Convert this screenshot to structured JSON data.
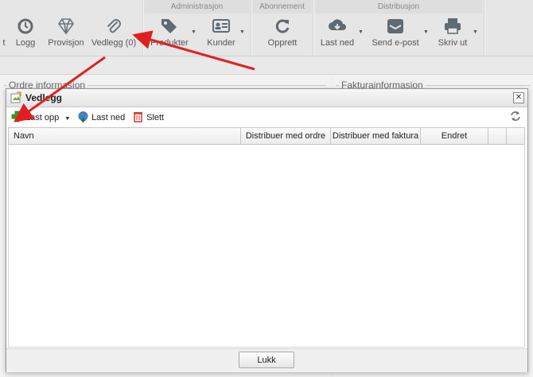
{
  "ribbon": {
    "groups": [
      "Administrasjon",
      "Abonnement",
      "Distribusjon"
    ],
    "buttons": {
      "logg": "Logg",
      "provisjon": "Provisjon",
      "vedlegg": "Vedlegg (0)",
      "produkter": "Produkter",
      "kunder": "Kunder",
      "opprett": "Opprett",
      "last_ned": "Last ned",
      "send_epost": "Send e-post",
      "skriv_ut": "Skriv ut"
    },
    "left_fragment": "t"
  },
  "background": {
    "left_title": "Ordre informasjon",
    "right_title": "Fakturainformasjon"
  },
  "dialog": {
    "title": "Vedlegg",
    "toolbar": {
      "upload": "Last opp",
      "download": "Last ned",
      "delete": "Slett"
    },
    "columns": [
      "Navn",
      "Distribuer med ordre",
      "Distribuer med faktura",
      "Endret"
    ],
    "rows": [],
    "close_button": "Lukk"
  },
  "colors": {
    "annotation_arrow": "#e02020",
    "upload_icon": "#2f9e2f",
    "delete_icon": "#d23b2b"
  }
}
